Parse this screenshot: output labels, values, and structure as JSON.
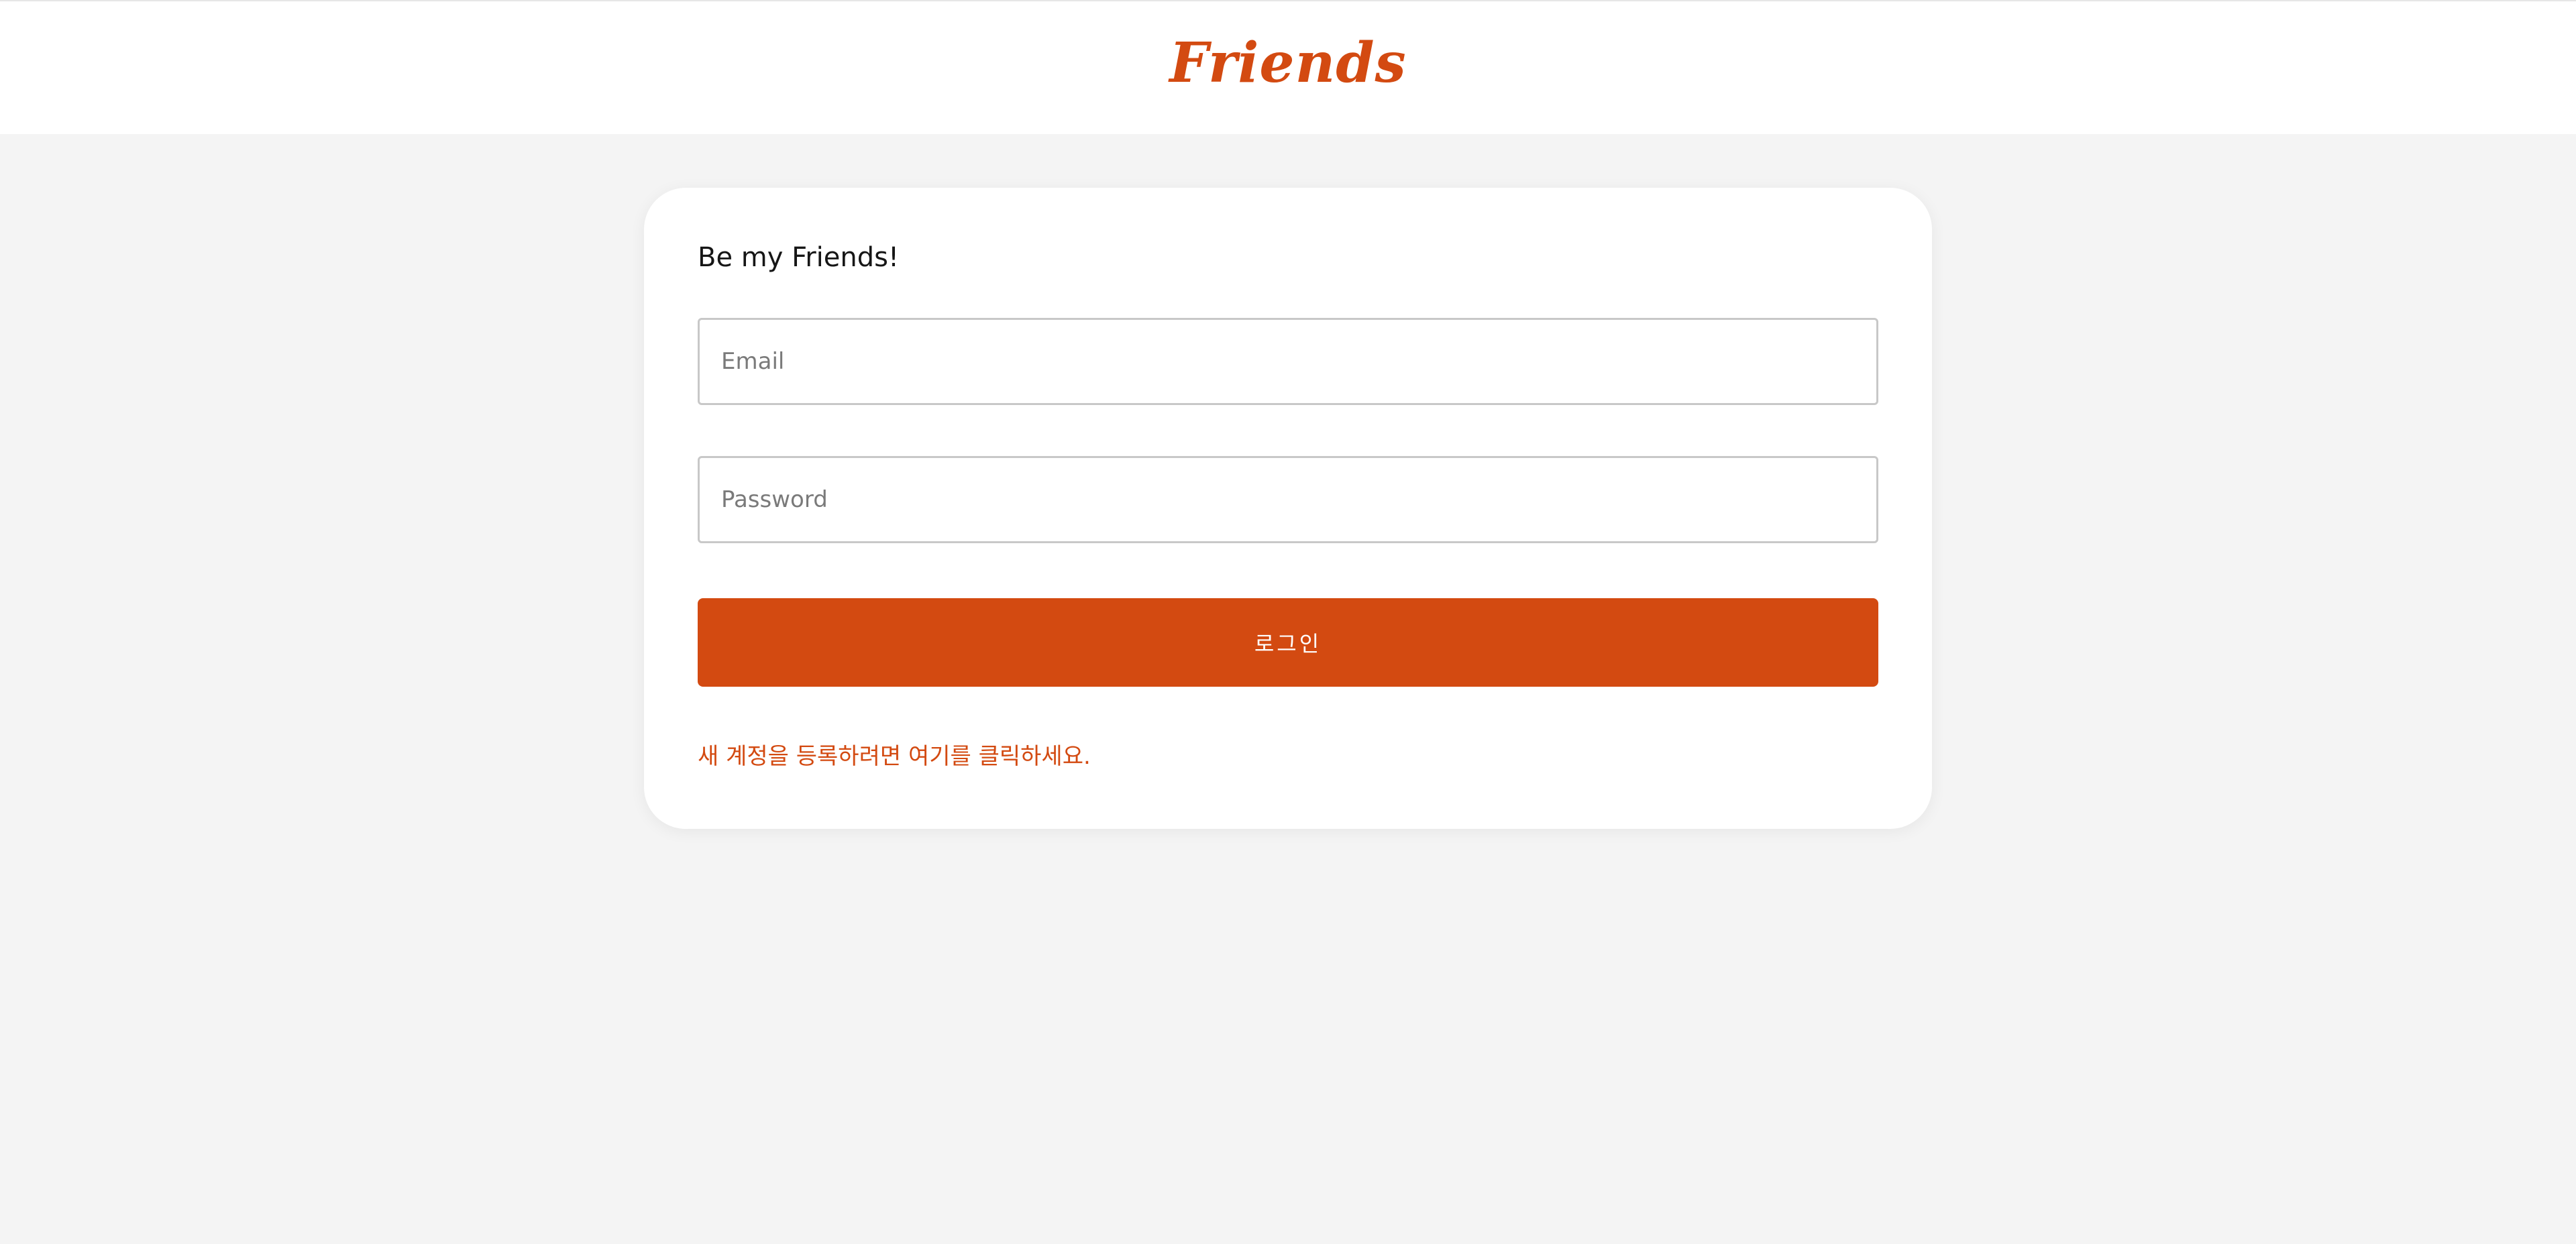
{
  "header": {
    "logo_text": "Friends"
  },
  "login_card": {
    "title": "Be my Friends!",
    "email_placeholder": "Email",
    "password_placeholder": "Password",
    "login_button_label": "로그인",
    "register_link_text": "새 계정을 등록하려면 여기를 클릭하세요."
  },
  "colors": {
    "brand": "#d34a11",
    "page_background": "#f4f4f4",
    "card_background": "#ffffff"
  }
}
